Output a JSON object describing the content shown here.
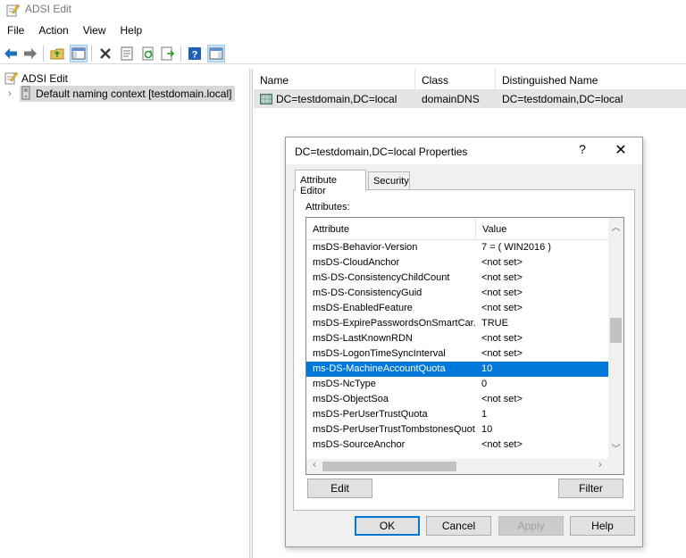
{
  "window": {
    "title": "ADSI Edit"
  },
  "menu": [
    "File",
    "Action",
    "View",
    "Help"
  ],
  "tree": {
    "root_label": "ADSI Edit",
    "node_label": "Default naming context [testdomain.local]"
  },
  "list": {
    "columns": [
      "Name",
      "Class",
      "Distinguished Name"
    ],
    "row": {
      "name": "DC=testdomain,DC=local",
      "class": "domainDNS",
      "dn": "DC=testdomain,DC=local"
    }
  },
  "dialog": {
    "title": "DC=testdomain,DC=local Properties",
    "help_glyph": "?",
    "close_glyph": "✕",
    "tabs": [
      "Attribute Editor",
      "Security"
    ],
    "attributes_label": "Attributes:",
    "columns": {
      "attribute": "Attribute",
      "value": "Value"
    },
    "rows": [
      {
        "attribute": "msDS-Behavior-Version",
        "value": "7 = ( WIN2016 )"
      },
      {
        "attribute": "msDS-CloudAnchor",
        "value": "<not set>"
      },
      {
        "attribute": "mS-DS-ConsistencyChildCount",
        "value": "<not set>"
      },
      {
        "attribute": "mS-DS-ConsistencyGuid",
        "value": "<not set>"
      },
      {
        "attribute": "msDS-EnabledFeature",
        "value": "<not set>"
      },
      {
        "attribute": "msDS-ExpirePasswordsOnSmartCar...",
        "value": "TRUE"
      },
      {
        "attribute": "msDS-LastKnownRDN",
        "value": "<not set>"
      },
      {
        "attribute": "msDS-LogonTimeSyncInterval",
        "value": "<not set>"
      },
      {
        "attribute": "ms-DS-MachineAccountQuota",
        "value": "10"
      },
      {
        "attribute": "msDS-NcType",
        "value": "0"
      },
      {
        "attribute": "msDS-ObjectSoa",
        "value": "<not set>"
      },
      {
        "attribute": "msDS-PerUserTrustQuota",
        "value": "1"
      },
      {
        "attribute": "msDS-PerUserTrustTombstonesQuota",
        "value": "10"
      },
      {
        "attribute": "msDS-SourceAnchor",
        "value": "<not set>"
      }
    ],
    "selected_row_index": 8,
    "buttons": {
      "edit": "Edit",
      "filter": "Filter",
      "ok": "OK",
      "cancel": "Cancel",
      "apply": "Apply",
      "help": "Help"
    }
  },
  "colors": {
    "selection": "#0078d7",
    "selected_tree_item": "#d9d9d9"
  }
}
